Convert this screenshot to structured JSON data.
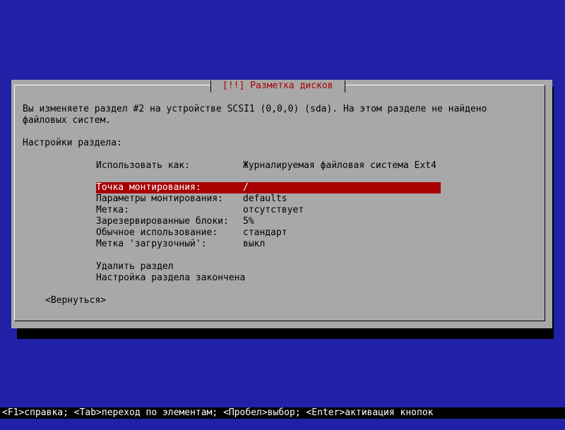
{
  "colors": {
    "background": "#2121a8",
    "dialog": "#a8a8a8",
    "title_text": "#a80000",
    "highlight": "#a80000",
    "highlight_text": "#ffffff",
    "status_bar": "#000000"
  },
  "dialog": {
    "title": "[!!] Разметка дисков",
    "message_line1": "Вы изменяете раздел #2 на устройстве SCSI1 (0,0,0) (sda). На этом разделе не найдено",
    "message_line2": "файловых систем.",
    "settings_heading": "Настройки раздела:",
    "use_as": {
      "label": "Использовать как:",
      "value": "Журналируемая файловая система Ext4"
    },
    "options": [
      {
        "label": "Точка монтирования:",
        "value": "/",
        "selected": true
      },
      {
        "label": "Параметры монтирования:",
        "value": "defaults",
        "selected": false
      },
      {
        "label": "Метка:",
        "value": "отсутствует",
        "selected": false
      },
      {
        "label": "Зарезервированные блоки:",
        "value": "5%",
        "selected": false
      },
      {
        "label": "Обычное использование:",
        "value": "стандарт",
        "selected": false
      },
      {
        "label": "Метка 'загрузочный':",
        "value": "выкл",
        "selected": false
      }
    ],
    "actions": {
      "delete_partition": "Удалить раздел",
      "done_setting_up": "Настройка раздела закончена"
    },
    "back_button": "<Вернуться>"
  },
  "status_bar": {
    "text": "<F1>справка; <Tab>переход по элементам; <Пробел>выбор; <Enter>активация кнопок"
  }
}
